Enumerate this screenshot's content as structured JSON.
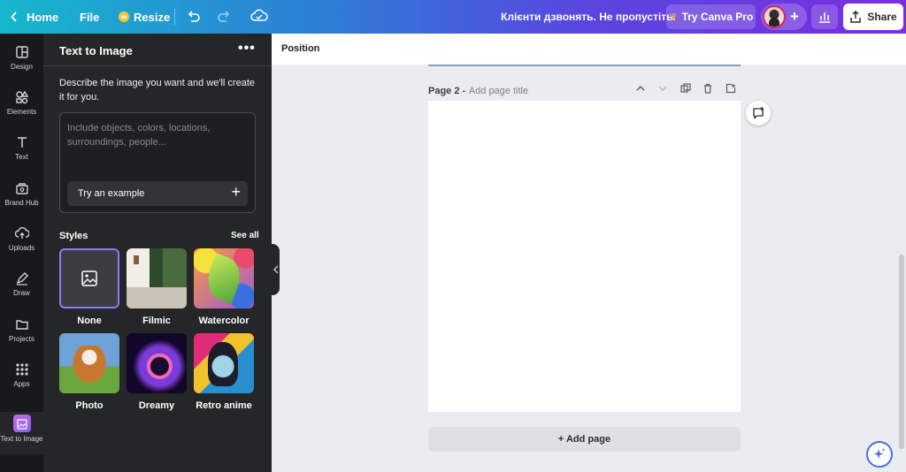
{
  "topbar": {
    "home_label": "Home",
    "file_label": "File",
    "resize_label": "Resize",
    "message": "Клієнти дзвонять. Не пропустіть.",
    "try_pro_label": "Try Canva Pro",
    "share_label": "Share"
  },
  "rail": {
    "items": [
      {
        "label": "Design",
        "icon": "design-icon"
      },
      {
        "label": "Elements",
        "icon": "elements-icon"
      },
      {
        "label": "Text",
        "icon": "text-icon"
      },
      {
        "label": "Brand Hub",
        "icon": "brand-hub-icon"
      },
      {
        "label": "Uploads",
        "icon": "uploads-icon"
      },
      {
        "label": "Draw",
        "icon": "draw-icon"
      },
      {
        "label": "Projects",
        "icon": "projects-icon"
      },
      {
        "label": "Apps",
        "icon": "apps-icon"
      },
      {
        "label": "Text to Image",
        "icon": "text-to-image-icon"
      }
    ]
  },
  "panel": {
    "title": "Text to Image",
    "more": "•••",
    "description": "Describe the image you want and we'll create it for you.",
    "prompt_placeholder": "Include objects, colors, locations, surroundings, people...",
    "example_label": "Try an example",
    "styles_title": "Styles",
    "see_all_label": "See all",
    "styles": [
      {
        "label": "None"
      },
      {
        "label": "Filmic"
      },
      {
        "label": "Watercolor"
      },
      {
        "label": "Photo"
      },
      {
        "label": "Dreamy"
      },
      {
        "label": "Retro anime"
      }
    ]
  },
  "canvas": {
    "context_label": "Position",
    "page_number": "Page 2 -",
    "page_title_placeholder": "Add page title",
    "add_page_label": "+ Add page"
  },
  "colors": {
    "gradient_start": "#16b7cc",
    "gradient_end": "#7a2ee0",
    "panel_bg": "#252627",
    "rail_bg": "#18191b",
    "selected_style_border": "#8b7cf6"
  }
}
